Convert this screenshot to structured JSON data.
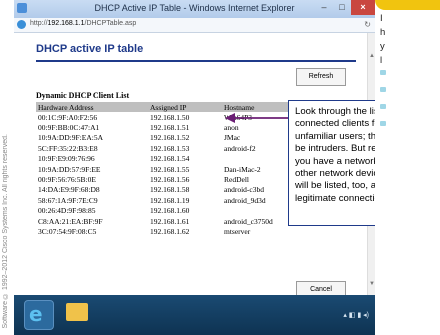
{
  "copyright": "Software © 1992–2012 Cisco Systems Inc. All rights reserved.",
  "window": {
    "title": "DHCP Active IP Table - Windows Internet Explorer",
    "url_prefix": "http://",
    "url_host": "192.168.1.1",
    "url_path": "/DHCPTable.asp",
    "minimize": "–",
    "maximize": "□",
    "close": "×"
  },
  "page": {
    "title": "DHCP active IP table",
    "refresh_label": "Refresh",
    "cancel_label": "Cancel",
    "list_title": "Dynamic DHCP Client List",
    "columns": [
      "Hardware Address",
      "Assigned IP",
      "Hostname"
    ],
    "rows": [
      [
        "00:1C:9F:A0:F2:56",
        "192.168.1.50",
        "Win64P3"
      ],
      [
        "00:9F:BB:0C:47:A1",
        "192.168.1.51",
        "anon"
      ],
      [
        "10:9A:DD:9F:EA:5A",
        "192.168.1.52",
        "JMac"
      ],
      [
        "5C:FF:35:22:B3:E8",
        "192.168.1.53",
        "android-f2"
      ],
      [
        "10:9F:E9:09:76:96",
        "192.168.1.54",
        ""
      ],
      [
        "10:9A:DD:57:9F:EE",
        "192.168.1.55",
        "Dan-iMac-2"
      ],
      [
        "00:9F:56:76:5B:0E",
        "192.168.1.56",
        "RedDell"
      ],
      [
        "14:DA:E9:9F:68:D8",
        "192.168.1.58",
        "android-c3bd"
      ],
      [
        "58:67:1A:9F:7E:C9",
        "192.168.1.19",
        "android_9d3d"
      ],
      [
        "00:26:4D:9F:98:85",
        "192.168.1.60",
        ""
      ],
      [
        "C8:AA:21:EA:BF:9F",
        "192.168.1.61",
        "android_c3750d"
      ],
      [
        "3C:07:54:9F:08:C5",
        "192.168.1.62",
        "mtserver"
      ]
    ]
  },
  "callout": {
    "text": "Look through the list of connected clients for unfamiliar users; they could be intruders. But remember, if you have a network printer or other network devices, they will be listed, too, and are legitimate connections."
  },
  "sidebar": {
    "line1": "I",
    "line2": "h",
    "line3": "y",
    "line4": "l"
  },
  "taskbar": {
    "ie_label": "e"
  },
  "colors": {
    "accent": "#1f3a8a",
    "sidebar_tab": "#f1c40f",
    "bullet": "#9fd6e6"
  },
  "icons": [
    "ie-icon",
    "folder-icon",
    "arrow-icon",
    "bullet-icon"
  ]
}
